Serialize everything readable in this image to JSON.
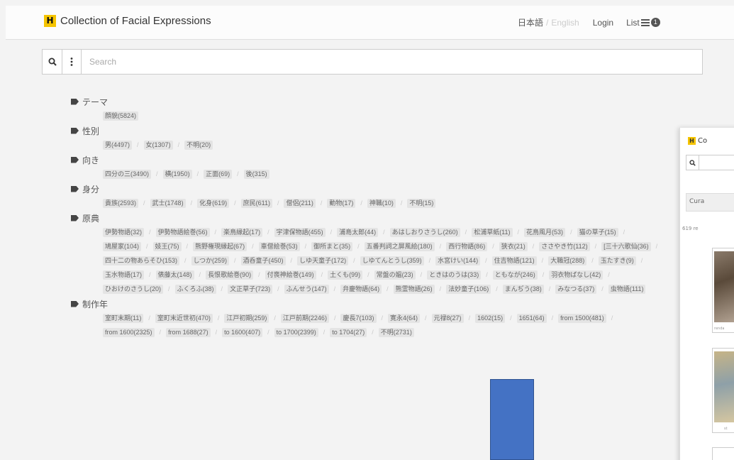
{
  "header": {
    "logo_letter": "H",
    "title": "Collection of Facial Expressions",
    "lang_ja": "日本語",
    "lang_sep": "/",
    "lang_en": "English",
    "login": "Login",
    "list": "List",
    "list_count": "1"
  },
  "search": {
    "placeholder": "Search",
    "search_icon": "search-icon",
    "more_icon": "vertical-ellipsis-icon"
  },
  "facets": [
    {
      "title": "テーマ",
      "items": [
        "顔貌(5824)"
      ]
    },
    {
      "title": "性別",
      "items": [
        "男(4497)",
        "女(1307)",
        "不明(20)"
      ]
    },
    {
      "title": "向き",
      "items": [
        "四分の三(3490)",
        "横(1950)",
        "正面(69)",
        "後(315)"
      ]
    },
    {
      "title": "身分",
      "items": [
        "貴族(2593)",
        "武士(1748)",
        "化身(619)",
        "庶民(611)",
        "僧侶(211)",
        "動物(17)",
        "神職(10)",
        "不明(15)"
      ]
    },
    {
      "title": "原典",
      "items": [
        "伊勢物語(32)",
        "伊勢物語絵巻(56)",
        "楽鳥縁起(17)",
        "宇津保物語(455)",
        "浦島太郎(44)",
        "あはしおりさうし(260)",
        "松浦草紙(11)",
        "花鳥風月(53)",
        "猫の草子(15)",
        "鳩屋家(104)",
        "妓王(75)",
        "熊野権現縁起(67)",
        "車僧絵巻(53)",
        "御所まと(35)",
        "五番判詞之屏風絵(180)",
        "西行物語(86)",
        "狭衣(21)",
        "ささやき竹(112)",
        "[三十六歌仙(36)",
        "四十二の物あらそひ(153)",
        "しつか(259)",
        "酒呑童子(450)",
        "しゆ天童子(172)",
        "しゆてんとうし(359)",
        "水宮けい(144)",
        "住吉物語(121)",
        "大職冠(288)",
        "玉たすき(9)",
        "玉水物語(17)",
        "俵藤太(148)",
        "長恨歌絵巻(90)",
        "付喪神絵巻(149)",
        "土くも(99)",
        "常盤の媼(23)",
        "ときはのうは(33)",
        "ともなが(246)",
        "羽衣物ばなし(42)",
        "ひおけのさうし(20)",
        "ふくろふ(38)",
        "文正草子(723)",
        "ふんせう(147)",
        "弁慶物語(64)",
        "熊霊物語(26)",
        "法妙童子(106)",
        "まんぢう(38)",
        "みなつる(37)",
        "虫物語(111)"
      ]
    },
    {
      "title": "制作年",
      "items": [
        "室町末期(11)",
        "室町末近世初(470)",
        "江戸初期(259)",
        "江戸前期(2246)",
        "慶長7(103)",
        "寛永4(64)",
        "元禄8(27)",
        "1602(15)",
        "1651(64)",
        "from 1500(481)",
        "from 1600(2325)",
        "from 1688(27)",
        "to 1600(407)",
        "to 1700(2399)",
        "to 1704(27)",
        "不明(2731)"
      ]
    }
  ],
  "overlay": {
    "logo_letter": "H",
    "title": "Co",
    "tab_label": "Cura",
    "result_count": "619 re",
    "thumb1_caption": "renda",
    "thumb2_caption": "st"
  }
}
